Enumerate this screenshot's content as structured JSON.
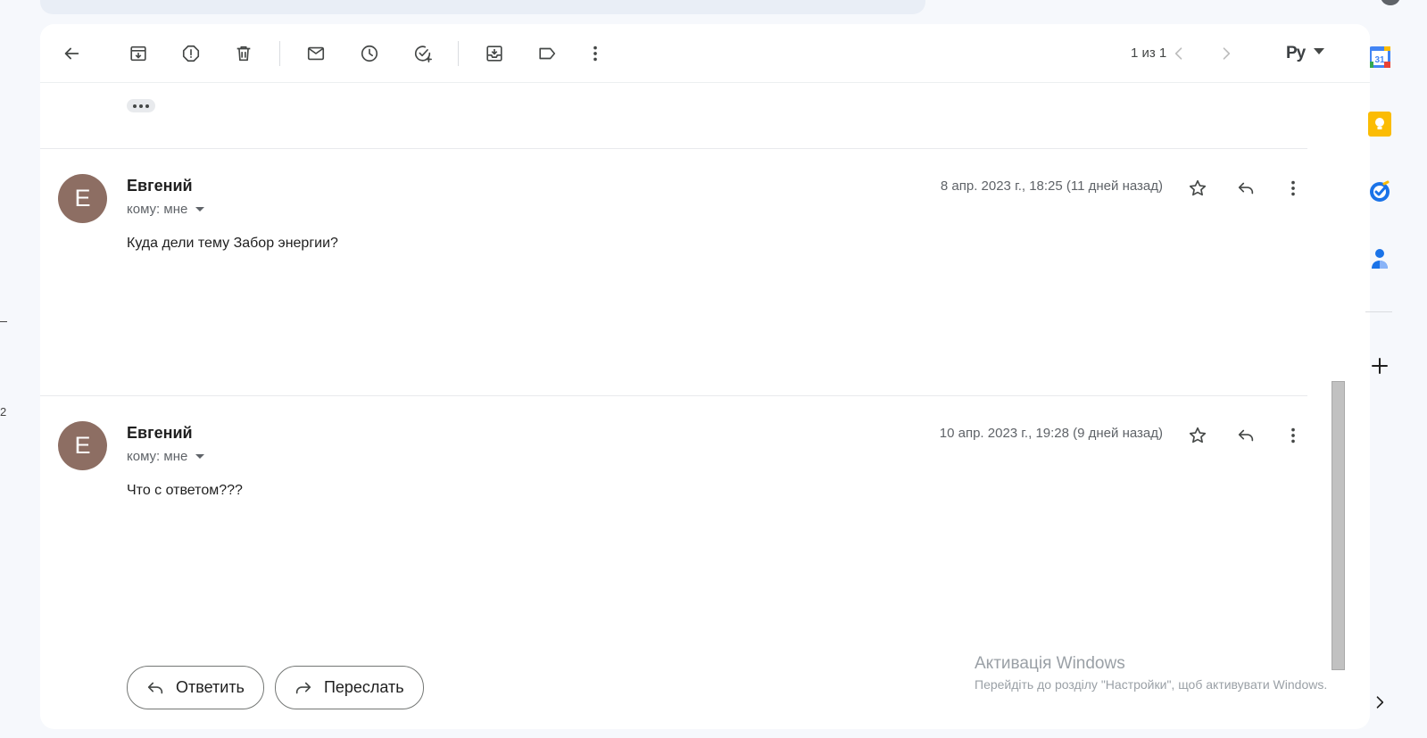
{
  "toolbar": {
    "pager_text": "1 из 1",
    "language": "Ру"
  },
  "messages": [
    {
      "avatar_letter": "Е",
      "sender": "Евгений",
      "to_label": "кому: мне",
      "date": "8 апр. 2023 г., 18:25 (11 дней назад)",
      "body": "Куда дели тему Забор энергии?"
    },
    {
      "avatar_letter": "Е",
      "sender": "Евгений",
      "to_label": "кому: мне",
      "date": "10 апр. 2023 г., 19:28 (9 дней назад)",
      "body": "Что с ответом???"
    }
  ],
  "actions": {
    "reply_label": "Ответить",
    "forward_label": "Переслать"
  },
  "watermark": {
    "title": "Активація Windows",
    "subtitle": "Перейдіть до розділу \"Настройки\", щоб активувати Windows."
  },
  "side_panel": {
    "calendar_day": "31"
  },
  "left_edge": {
    "count": "2"
  }
}
